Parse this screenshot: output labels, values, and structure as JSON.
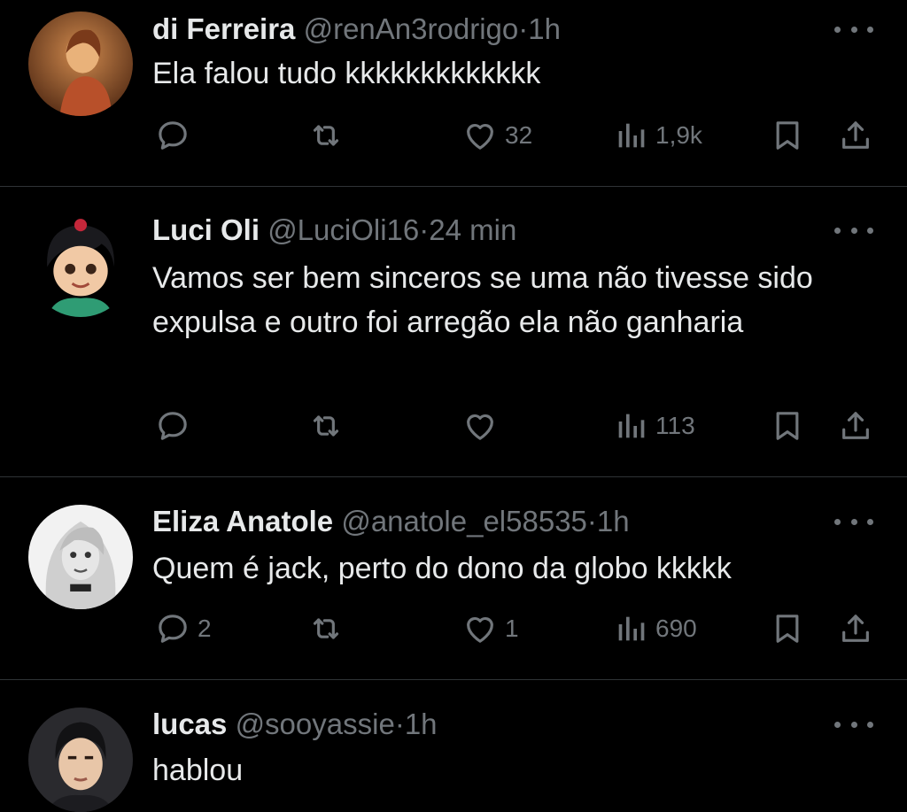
{
  "tweets": [
    {
      "name": "di Ferreira",
      "handle": "@renAn3rodrigo",
      "sep": "·",
      "time": "1h",
      "text": "Ela falou tudo kkkkkkkkkkkkk",
      "replies": "",
      "retweets": "",
      "likes": "32",
      "views": "1,9k"
    },
    {
      "name": "Luci Oli",
      "handle": "@LuciOli16",
      "sep": "·",
      "time": "24 min",
      "text": "Vamos ser bem sinceros se uma não tivesse sido expulsa e outro foi arregão ela não ganharia",
      "replies": "",
      "retweets": "",
      "likes": "",
      "views": "113"
    },
    {
      "name": "Eliza Anatole",
      "handle": "@anatole_el58535",
      "sep": "·",
      "time": "1h",
      "text": "Quem é jack, perto do dono da globo kkkkk",
      "replies": "2",
      "retweets": "",
      "likes": "1",
      "views": "690"
    },
    {
      "name": "lucas",
      "handle": "@sooyassie",
      "sep": "·",
      "time": "1h",
      "text": "hablou"
    }
  ],
  "icons": {
    "reply": "reply-icon",
    "retweet": "retweet-icon",
    "like": "heart-icon",
    "views": "views-icon",
    "bookmark": "bookmark-icon",
    "share": "share-icon",
    "more": "more-icon"
  },
  "colors": {
    "background": "#000000",
    "text": "#e7e9ea",
    "muted": "#71767b",
    "divider": "#2f3336"
  }
}
